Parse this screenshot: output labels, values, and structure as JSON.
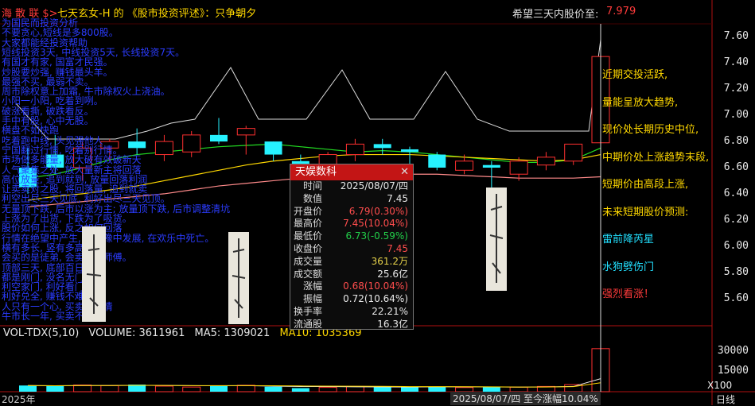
{
  "header": {
    "title_red": "海 散 联 $>",
    "title_yellow": "七天玄女-H  的 《股市投资评述》：只争朝夕",
    "target_label": "希望三天内股价至:",
    "target_value": "7.979"
  },
  "left_notes": [
    "为国民而投资分析",
    "不要贪心,短线是多800股。",
    "大家都能经投资帮助",
    "短线投资3天, 中线投资5天, 长线投资7天。",
    "有国才有家, 国富才民强。",
    "炒股要炒强, 赚钱最头羊。",
    "最强不买, 最弱不卖。",
    "周市除权意上加霜, 牛市除权火上浇油。",
    "小阳一小阳, 吃着到咧。",
    "破涨看撕, 破跌看反。",
    "手中有股, 心中无股。",
    "横盘不如快跑",
    "吃着跑中线, 头见强他人",
    "宁国翻过行情, 吃着别行情。",
    "市场做多能量, 放大破有效破新天",
    "人气聚集之处, 放大量新主将回落",
    "高位放量, 追到就到, 放量回落利润",
    "让卖卖对之股, 将回落量, 追到就卖",
    "利空出尽三天见底, 利好出尽三天见顶。",
    "无量顶下跌, 后市以涨为主; 放量顶下跌, 后市调整清坑",
    "上涨为了出货, 下跌为了吸货。",
    "股价如何上涨, 反之如何回落",
    "行情在绝望中产生, 在犹豫中发展, 在欢乐中死亡。",
    "横有多长, 竖有多高。",
    "会买的是徒弟, 会卖的是师傅。",
    "顶部三天, 底部百日",
    "都是刚门, 没名无门",
    "利空家门, 利好看门",
    "利好兑全, 赚钱不难",
    "人只有一个心, 买卖门行情",
    "牛市长一年, 买卖不熊"
  ],
  "right_annotations": [
    {
      "text": "近期交投活跃,",
      "color": "#ffd800"
    },
    {
      "text": "量能呈放大趋势,",
      "color": "#ffd800"
    },
    {
      "text": "现价处长期历史中位,",
      "color": "#ffd800"
    },
    {
      "text": "中期价处上涨趋势末段,",
      "color": "#ffd800"
    },
    {
      "text": "短期价由高段上涨,",
      "color": "#ffd800"
    },
    {
      "text": "未来短期股价预测:",
      "color": "#ffd800"
    },
    {
      "text": "雷前降芮星",
      "color": "#22e0ff"
    },
    {
      "text": "水狗劈伤门",
      "color": "#22e0ff"
    },
    {
      "text": "强烈看涨！",
      "color": "#ff3b3b"
    }
  ],
  "price_axis": [
    "7.60",
    "7.40",
    "7.20",
    "7.00",
    "6.80",
    "6.60",
    "6.40",
    "6.20",
    "6.00",
    "5.80",
    "5.60"
  ],
  "volume_axis": [
    "30000",
    "15000"
  ],
  "volume_panel": {
    "label_name": "VOL-TDX(5,10)",
    "label_vol": "VOLUME: 3611961",
    "label_ma5": "MA5: 1309021",
    "label_ma10": "MA10: 1035369",
    "unit": "X100"
  },
  "popup": {
    "title": "天娱数科",
    "close_glyph": "✕",
    "rows": [
      {
        "label": "时间",
        "value": "2025/08/07/四",
        "color": "#e8e8e8"
      },
      {
        "label": "数值",
        "value": "7.45",
        "color": "#e8e8e8"
      },
      {
        "label": "开盘价",
        "value": "6.79(0.30%)",
        "color": "#ff4d4d"
      },
      {
        "label": "最高价",
        "value": "7.45(10.04%)",
        "color": "#ff4d4d"
      },
      {
        "label": "最低价",
        "value": "6.73(-0.59%)",
        "color": "#22d04a"
      },
      {
        "label": "收盘价",
        "value": "7.45",
        "color": "#ff4d4d"
      },
      {
        "label": "成交量",
        "value": "361.2万",
        "color": "#e6d24a"
      },
      {
        "label": "成交额",
        "value": "25.6亿",
        "color": "#e8e8e8"
      },
      {
        "label": "涨幅",
        "value": "0.68(10.04%)",
        "color": "#ff4d4d"
      },
      {
        "label": "振幅",
        "value": "0.72(10.64%)",
        "color": "#e8e8e8"
      },
      {
        "label": "换手率",
        "value": "22.21%",
        "color": "#e8e8e8"
      },
      {
        "label": "流通股",
        "value": "16.3亿",
        "color": "#e8e8e8"
      }
    ]
  },
  "footer": {
    "year": "2025年",
    "date_info": "2025/08/07/四 至今涨幅10.04%",
    "period": "日线"
  },
  "chart_data": {
    "type": "candlestick",
    "ylim": [
      5.5,
      7.7
    ],
    "candles": [
      {
        "o": 6.6,
        "h": 6.75,
        "l": 6.4,
        "c": 6.45
      },
      {
        "o": 6.7,
        "h": 6.85,
        "l": 6.55,
        "c": 6.6
      },
      {
        "o": 6.6,
        "h": 6.8,
        "l": 6.5,
        "c": 6.75
      },
      {
        "o": 6.75,
        "h": 6.82,
        "l": 6.65,
        "c": 6.8
      },
      {
        "o": 6.8,
        "h": 6.9,
        "l": 6.7,
        "c": 6.75
      },
      {
        "o": 6.7,
        "h": 6.85,
        "l": 6.65,
        "c": 6.8
      },
      {
        "o": 6.72,
        "h": 6.88,
        "l": 6.68,
        "c": 6.85
      },
      {
        "o": 6.85,
        "h": 6.98,
        "l": 6.78,
        "c": 6.8
      },
      {
        "o": 6.85,
        "h": 6.92,
        "l": 6.7,
        "c": 6.9
      },
      {
        "o": 6.8,
        "h": 6.8,
        "l": 6.65,
        "c": 6.7
      },
      {
        "o": 6.65,
        "h": 6.7,
        "l": 6.55,
        "c": 6.58
      },
      {
        "o": 6.6,
        "h": 6.72,
        "l": 6.55,
        "c": 6.7
      },
      {
        "o": 6.7,
        "h": 6.82,
        "l": 6.65,
        "c": 6.78
      },
      {
        "o": 6.78,
        "h": 6.82,
        "l": 6.7,
        "c": 6.75
      },
      {
        "o": 6.74,
        "h": 6.76,
        "l": 6.62,
        "c": 6.72
      },
      {
        "o": 6.7,
        "h": 6.72,
        "l": 6.58,
        "c": 6.6
      },
      {
        "o": 6.58,
        "h": 6.7,
        "l": 6.55,
        "c": 6.65
      },
      {
        "o": 6.62,
        "h": 6.65,
        "l": 6.4,
        "c": 6.6
      },
      {
        "o": 6.55,
        "h": 6.68,
        "l": 6.5,
        "c": 6.65
      },
      {
        "o": 6.62,
        "h": 6.72,
        "l": 6.58,
        "c": 6.68
      },
      {
        "o": 6.65,
        "h": 6.78,
        "l": 6.62,
        "c": 6.78
      },
      {
        "o": 6.79,
        "h": 7.45,
        "l": 6.73,
        "c": 7.45
      }
    ],
    "volume": [
      520,
      480,
      560,
      510,
      600,
      470,
      390,
      530,
      540,
      420,
      300,
      360,
      440,
      460,
      380,
      400,
      350,
      420,
      380,
      440,
      600,
      3612
    ],
    "ma_short": [
      6.52,
      6.55,
      6.6,
      6.66,
      6.7,
      6.72,
      6.74,
      6.76,
      6.77,
      6.78,
      6.76,
      6.74,
      6.72,
      6.73,
      6.72,
      6.7,
      6.68,
      6.66,
      6.64,
      6.64,
      6.66,
      6.75
    ],
    "ma_mid": [
      6.35,
      6.38,
      6.4,
      6.43,
      6.46,
      6.5,
      6.54,
      6.58,
      6.62,
      6.65,
      6.67,
      6.69,
      6.7,
      6.7,
      6.7,
      6.69,
      6.68,
      6.67,
      6.66,
      6.65,
      6.66,
      6.7
    ],
    "ma_long": [
      6.3,
      6.32,
      6.34,
      6.36,
      6.38,
      6.4,
      6.43,
      6.46,
      6.48,
      6.5,
      6.52,
      6.53,
      6.54,
      6.55,
      6.55,
      6.55,
      6.54,
      6.53,
      6.52,
      6.52,
      6.52,
      6.53
    ]
  }
}
